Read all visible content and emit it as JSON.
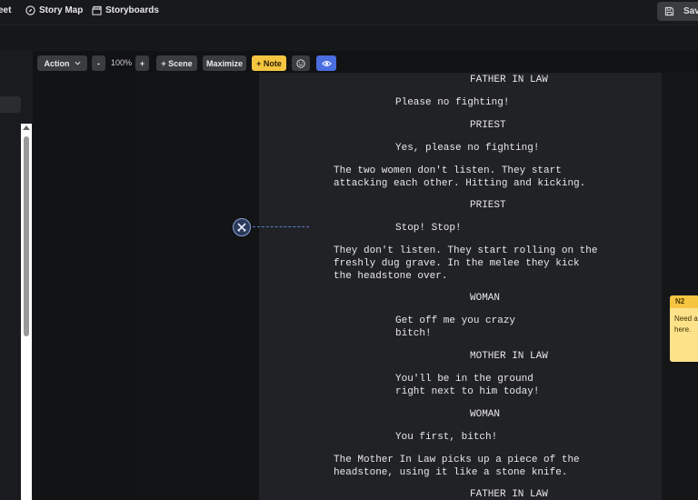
{
  "topbar": {
    "nav": [
      {
        "label": "eet",
        "icon": "sheet-icon"
      },
      {
        "label": "Story Map",
        "icon": "compass-icon"
      },
      {
        "label": "Storyboards",
        "icon": "clapperboard-icon"
      }
    ],
    "save_label": "Save"
  },
  "toolbar": {
    "action_label": "Action",
    "zoom_out": "-",
    "zoom_value": "100%",
    "zoom_in": "+",
    "scene_label": "+ Scene",
    "maximize_label": "Maximize",
    "note_label": "+ Note"
  },
  "colors": {
    "note_button": "#f5c542",
    "eye_button": "#4a6ee0",
    "marker_line": "#5b7bd6"
  },
  "script": [
    {
      "type": "character",
      "text": "FATHER IN LAW"
    },
    {
      "type": "dialogue",
      "text": "Please no fighting!"
    },
    {
      "type": "character",
      "text": "PRIEST"
    },
    {
      "type": "dialogue",
      "text": "Yes, please no fighting!"
    },
    {
      "type": "action",
      "text": "The two women don't listen. They start\nattacking each other. Hitting and kicking."
    },
    {
      "type": "character",
      "text": "PRIEST"
    },
    {
      "type": "dialogue",
      "text": "Stop! Stop!"
    },
    {
      "type": "action",
      "text": "They don't listen. They start rolling on the\nfreshly dug grave. In the melee they kick\nthe headstone over."
    },
    {
      "type": "character",
      "text": "WOMAN"
    },
    {
      "type": "dialogue",
      "text": "Get off me you crazy\nbitch!"
    },
    {
      "type": "character",
      "text": "MOTHER IN LAW"
    },
    {
      "type": "dialogue",
      "text": "You'll be in the ground\nright next to him today!"
    },
    {
      "type": "character",
      "text": "WOMAN"
    },
    {
      "type": "dialogue",
      "text": "You first, bitch!"
    },
    {
      "type": "action",
      "text": "The Mother In Law picks up a piece of the\nheadstone, using it like a stone knife."
    },
    {
      "type": "character",
      "text": "FATHER IN LAW"
    }
  ],
  "note": {
    "id": "N2",
    "text": "Need a\nhere."
  }
}
